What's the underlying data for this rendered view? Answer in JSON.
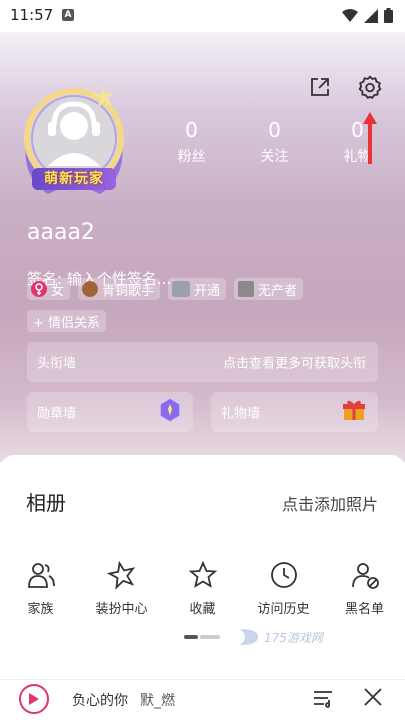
{
  "status_bar": {
    "time": "11:57"
  },
  "profile": {
    "avatar_badge": "萌新玩家",
    "username": "aaaa2",
    "signature": "签名: 输入个性签名...",
    "stats": [
      {
        "value": "0",
        "label": "粉丝"
      },
      {
        "value": "0",
        "label": "关注"
      },
      {
        "value": "0",
        "label": "礼物"
      }
    ],
    "tags": {
      "gender": "女",
      "level": "青铜歌手",
      "vip": "开通",
      "producer": "无产者",
      "couple": "+ 情侣关系"
    },
    "title_wall": {
      "label": "头衔墙",
      "hint": "点击查看更多可获取头衔"
    },
    "medal_wall": {
      "label": "勋章墙"
    },
    "gift_wall": {
      "label": "礼物墙"
    }
  },
  "album": {
    "title": "相册",
    "add_label": "点击添加照片"
  },
  "quick_actions": [
    {
      "label": "家族",
      "icon": "family-icon"
    },
    {
      "label": "装扮中心",
      "icon": "dressup-icon"
    },
    {
      "label": "收藏",
      "icon": "star-icon"
    },
    {
      "label": "访问历史",
      "icon": "clock-icon"
    },
    {
      "label": "黑名单",
      "icon": "blacklist-icon"
    }
  ],
  "watermark": "175游戏网",
  "music_bar": {
    "song": "负心的你",
    "artist": "默_燃"
  },
  "colors": {
    "accent": "#e0336f",
    "arrow": "#e8333a",
    "badge": "#7a50d0"
  }
}
